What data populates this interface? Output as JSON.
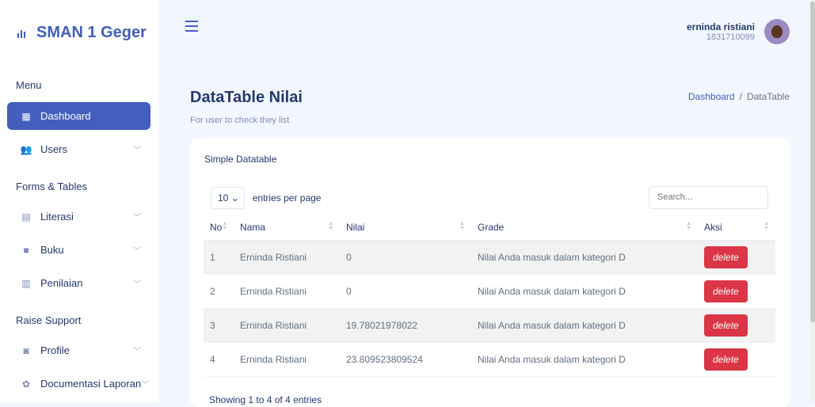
{
  "brand": {
    "title": "SMAN 1 Geger"
  },
  "sidebar": {
    "section_menu": "Menu",
    "section_forms": "Forms & Tables",
    "section_support": "Raise Support",
    "items": [
      {
        "label": "Dashboard",
        "icon": "grid-icon"
      },
      {
        "label": "Users",
        "icon": "users-icon"
      },
      {
        "label": "Literasi",
        "icon": "book-open-icon"
      },
      {
        "label": "Buku",
        "icon": "book-icon"
      },
      {
        "label": "Penilaian",
        "icon": "file-icon"
      },
      {
        "label": "Profile",
        "icon": "profile-icon"
      },
      {
        "label": "Documentasi Laporan",
        "icon": "gear-icon"
      }
    ]
  },
  "user": {
    "name": "erninda ristiani",
    "id": "1831710099"
  },
  "page": {
    "title": "DataTable Nilai",
    "subtitle": "For user to check they list",
    "breadcrumb": {
      "home": "Dashboard",
      "sep": "/",
      "current": "DataTable"
    }
  },
  "card": {
    "header": "Simple Datatable",
    "per_page_value": "10",
    "per_page_label": "entries per page",
    "search_placeholder": "Search...",
    "columns": [
      "No",
      "Nama",
      "Nilai",
      "Grade",
      "Aksi"
    ],
    "rows": [
      {
        "no": "1",
        "nama": "Erninda Ristiani",
        "nilai": "0",
        "grade": "Nilai Anda masuk dalam kategori D",
        "aksi": "delete"
      },
      {
        "no": "2",
        "nama": "Erninda Ristiani",
        "nilai": "0",
        "grade": "Nilai Anda masuk dalam kategori D",
        "aksi": "delete"
      },
      {
        "no": "3",
        "nama": "Erninda Ristiani",
        "nilai": "19.78021978022",
        "grade": "Nilai Anda masuk dalam kategori D",
        "aksi": "delete"
      },
      {
        "no": "4",
        "nama": "Erninda Ristiani",
        "nilai": "23.809523809524",
        "grade": "Nilai Anda masuk dalam kategori D",
        "aksi": "delete"
      }
    ],
    "showing": "Showing 1 to 4 of 4 entries"
  },
  "colors": {
    "accent": "#435ebe",
    "danger": "#dc3545"
  }
}
